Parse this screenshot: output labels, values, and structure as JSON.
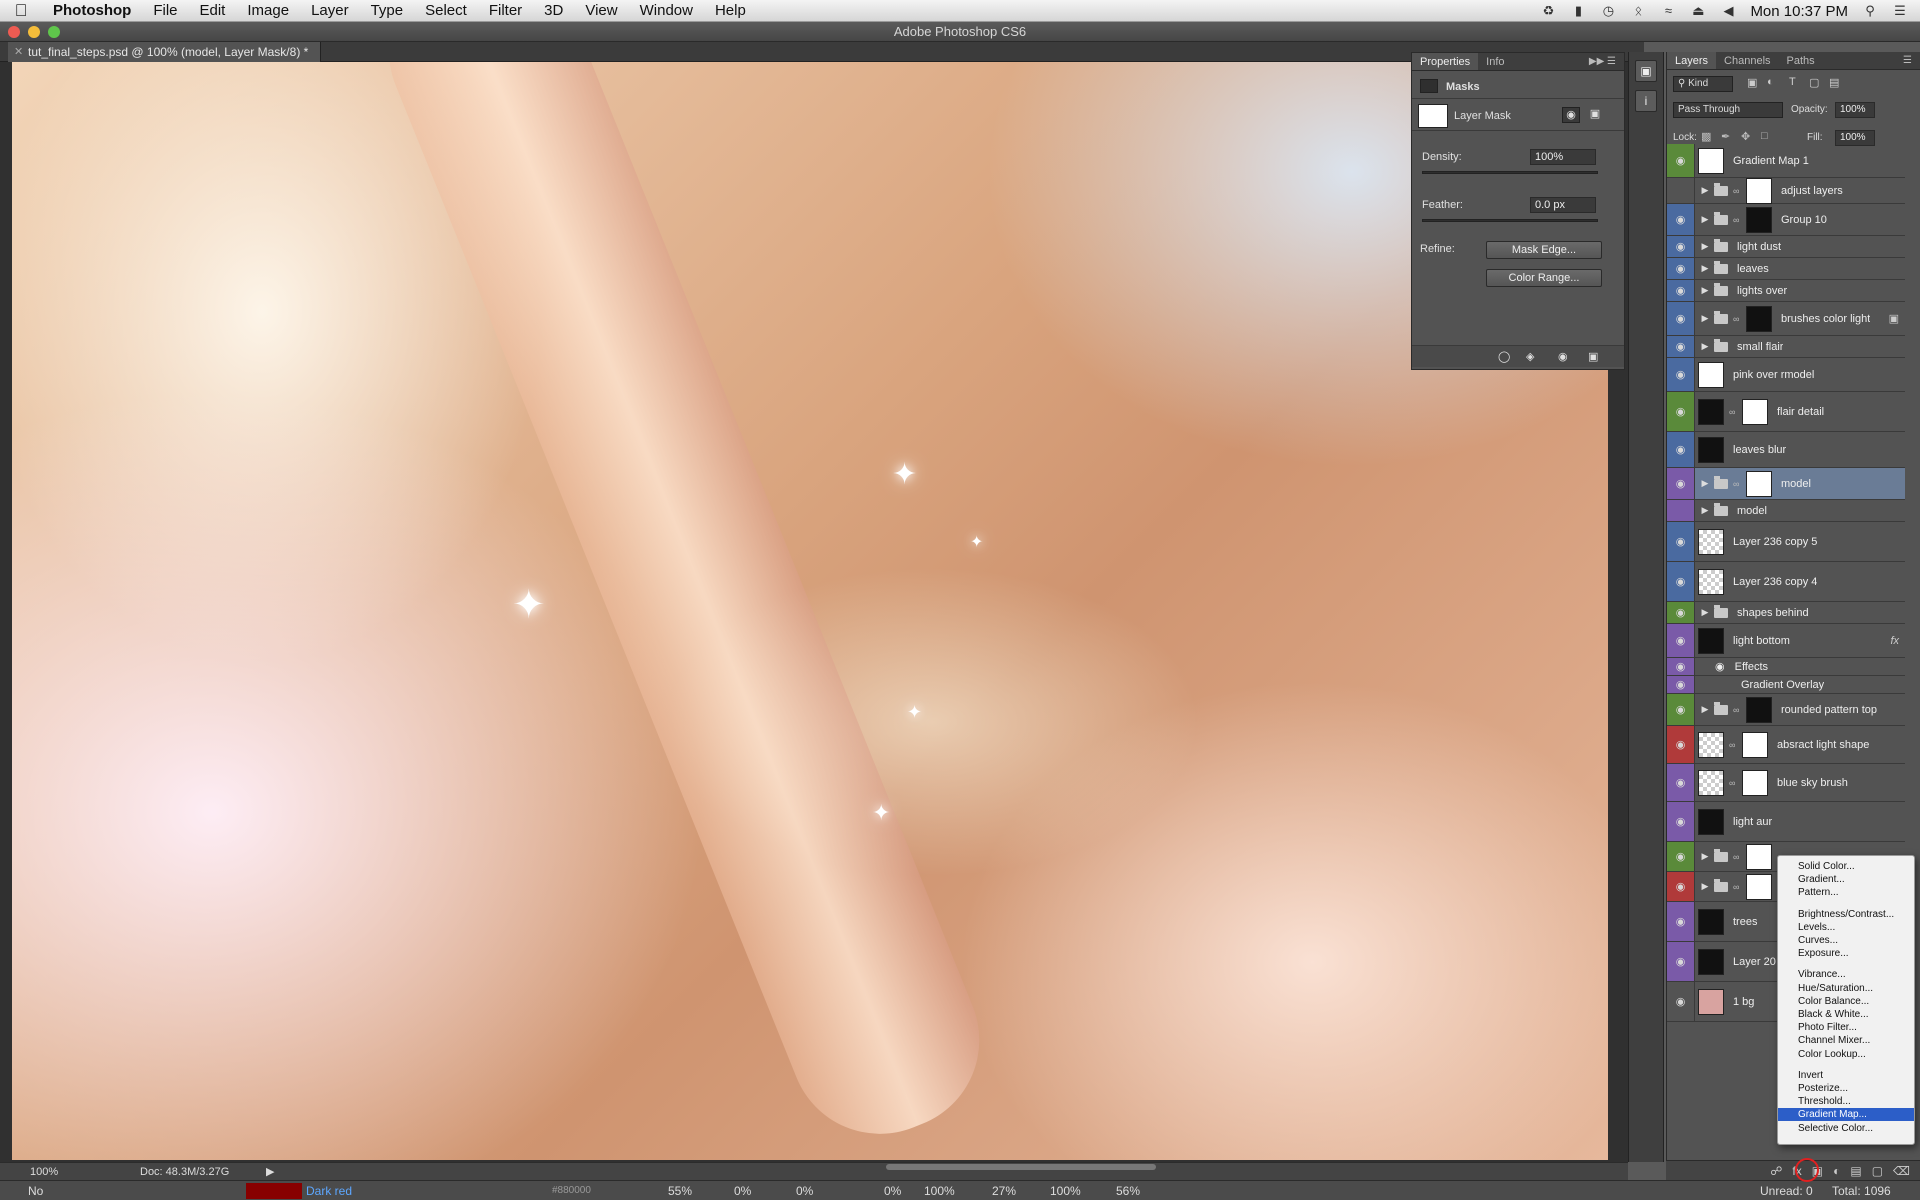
{
  "menubar": {
    "items": [
      "Photoshop",
      "File",
      "Edit",
      "Image",
      "Layer",
      "Type",
      "Select",
      "Filter",
      "3D",
      "View",
      "Window",
      "Help"
    ],
    "clock": "Mon 10:37 PM"
  },
  "window": {
    "title": "Adobe Photoshop CS6"
  },
  "document": {
    "tab_title": "tut_final_steps.psd @ 100% (model, Layer Mask/8) *"
  },
  "status": {
    "zoom": "100%",
    "doc_size": "Doc: 48.3M/3.27G"
  },
  "info_strip": {
    "no": "No",
    "swatch_name": "Dark red",
    "swatch_hex": "#880000",
    "swatch_color": "#880000",
    "values": [
      "55%",
      "0%",
      "0%",
      "0%",
      "100%",
      "27%",
      "100%",
      "56%"
    ],
    "unread": "Unread: 0",
    "total": "Total: 1096"
  },
  "properties": {
    "tabs": [
      "Properties",
      "Info"
    ],
    "section": "Masks",
    "mask_label": "Layer Mask",
    "density_label": "Density:",
    "density_value": "100%",
    "feather_label": "Feather:",
    "feather_value": "0.0 px",
    "refine_label": "Refine:",
    "mask_edge_btn": "Mask Edge...",
    "color_range_btn": "Color Range..."
  },
  "layers_panel": {
    "tabs": [
      "Layers",
      "Channels",
      "Paths"
    ],
    "filter_kind": "Kind",
    "blend_mode": "Pass Through",
    "opacity_label": "Opacity:",
    "opacity_value": "100%",
    "lock_label": "Lock:",
    "fill_label": "Fill:",
    "fill_value": "100%",
    "layers": [
      {
        "name": "Gradient Map 1",
        "tag": "#5a8a3a"
      },
      {
        "name": "adjust layers",
        "tag": "#535353"
      },
      {
        "name": "Group 10",
        "tag": "#4a6aa0"
      },
      {
        "name": "light dust",
        "tag": "#4a6aa0"
      },
      {
        "name": "leaves",
        "tag": "#4a6aa0"
      },
      {
        "name": "lights over",
        "tag": "#4a6aa0"
      },
      {
        "name": "brushes color light",
        "tag": "#4a6aa0"
      },
      {
        "name": "small flair",
        "tag": "#4a6aa0"
      },
      {
        "name": "pink over rmodel",
        "tag": "#4a6aa0"
      },
      {
        "name": "flair detail",
        "tag": "#5a8a3a"
      },
      {
        "name": "leaves blur",
        "tag": "#4a6aa0"
      },
      {
        "name": "model",
        "tag": "#7a5aa8"
      },
      {
        "name": "model",
        "tag": "#7a5aa8"
      },
      {
        "name": "Layer 236 copy 5",
        "tag": "#4a6aa0"
      },
      {
        "name": "Layer 236 copy 4",
        "tag": "#4a6aa0"
      },
      {
        "name": "shapes behind",
        "tag": "#5a8a3a"
      },
      {
        "name": "light bottom",
        "tag": "#7a5aa8"
      },
      {
        "name": "Effects",
        "tag": "#7a5aa8"
      },
      {
        "name": "Gradient Overlay",
        "tag": "#7a5aa8"
      },
      {
        "name": "rounded pattern top",
        "tag": "#5a8a3a"
      },
      {
        "name": "absract light shape",
        "tag": "#b03a3a"
      },
      {
        "name": "blue sky brush",
        "tag": "#7a5aa8"
      },
      {
        "name": "light aur",
        "tag": "#7a5aa8"
      },
      {
        "name": "",
        "tag": "#5a8a3a"
      },
      {
        "name": "",
        "tag": "#b03a3a"
      },
      {
        "name": "trees",
        "tag": "#7a5aa8"
      },
      {
        "name": "Layer 20",
        "tag": "#7a5aa8"
      },
      {
        "name": "1 bg",
        "tag": "#535353"
      }
    ]
  },
  "adjustment_menu": {
    "items": [
      "Solid Color...",
      "Gradient...",
      "Pattern...",
      "Brightness/Contrast...",
      "Levels...",
      "Curves...",
      "Exposure...",
      "Vibrance...",
      "Hue/Saturation...",
      "Color Balance...",
      "Black & White...",
      "Photo Filter...",
      "Channel Mixer...",
      "Color Lookup...",
      "Invert",
      "Posterize...",
      "Threshold...",
      "Gradient Map...",
      "Selective Color..."
    ],
    "highlighted": "Gradient Map..."
  }
}
